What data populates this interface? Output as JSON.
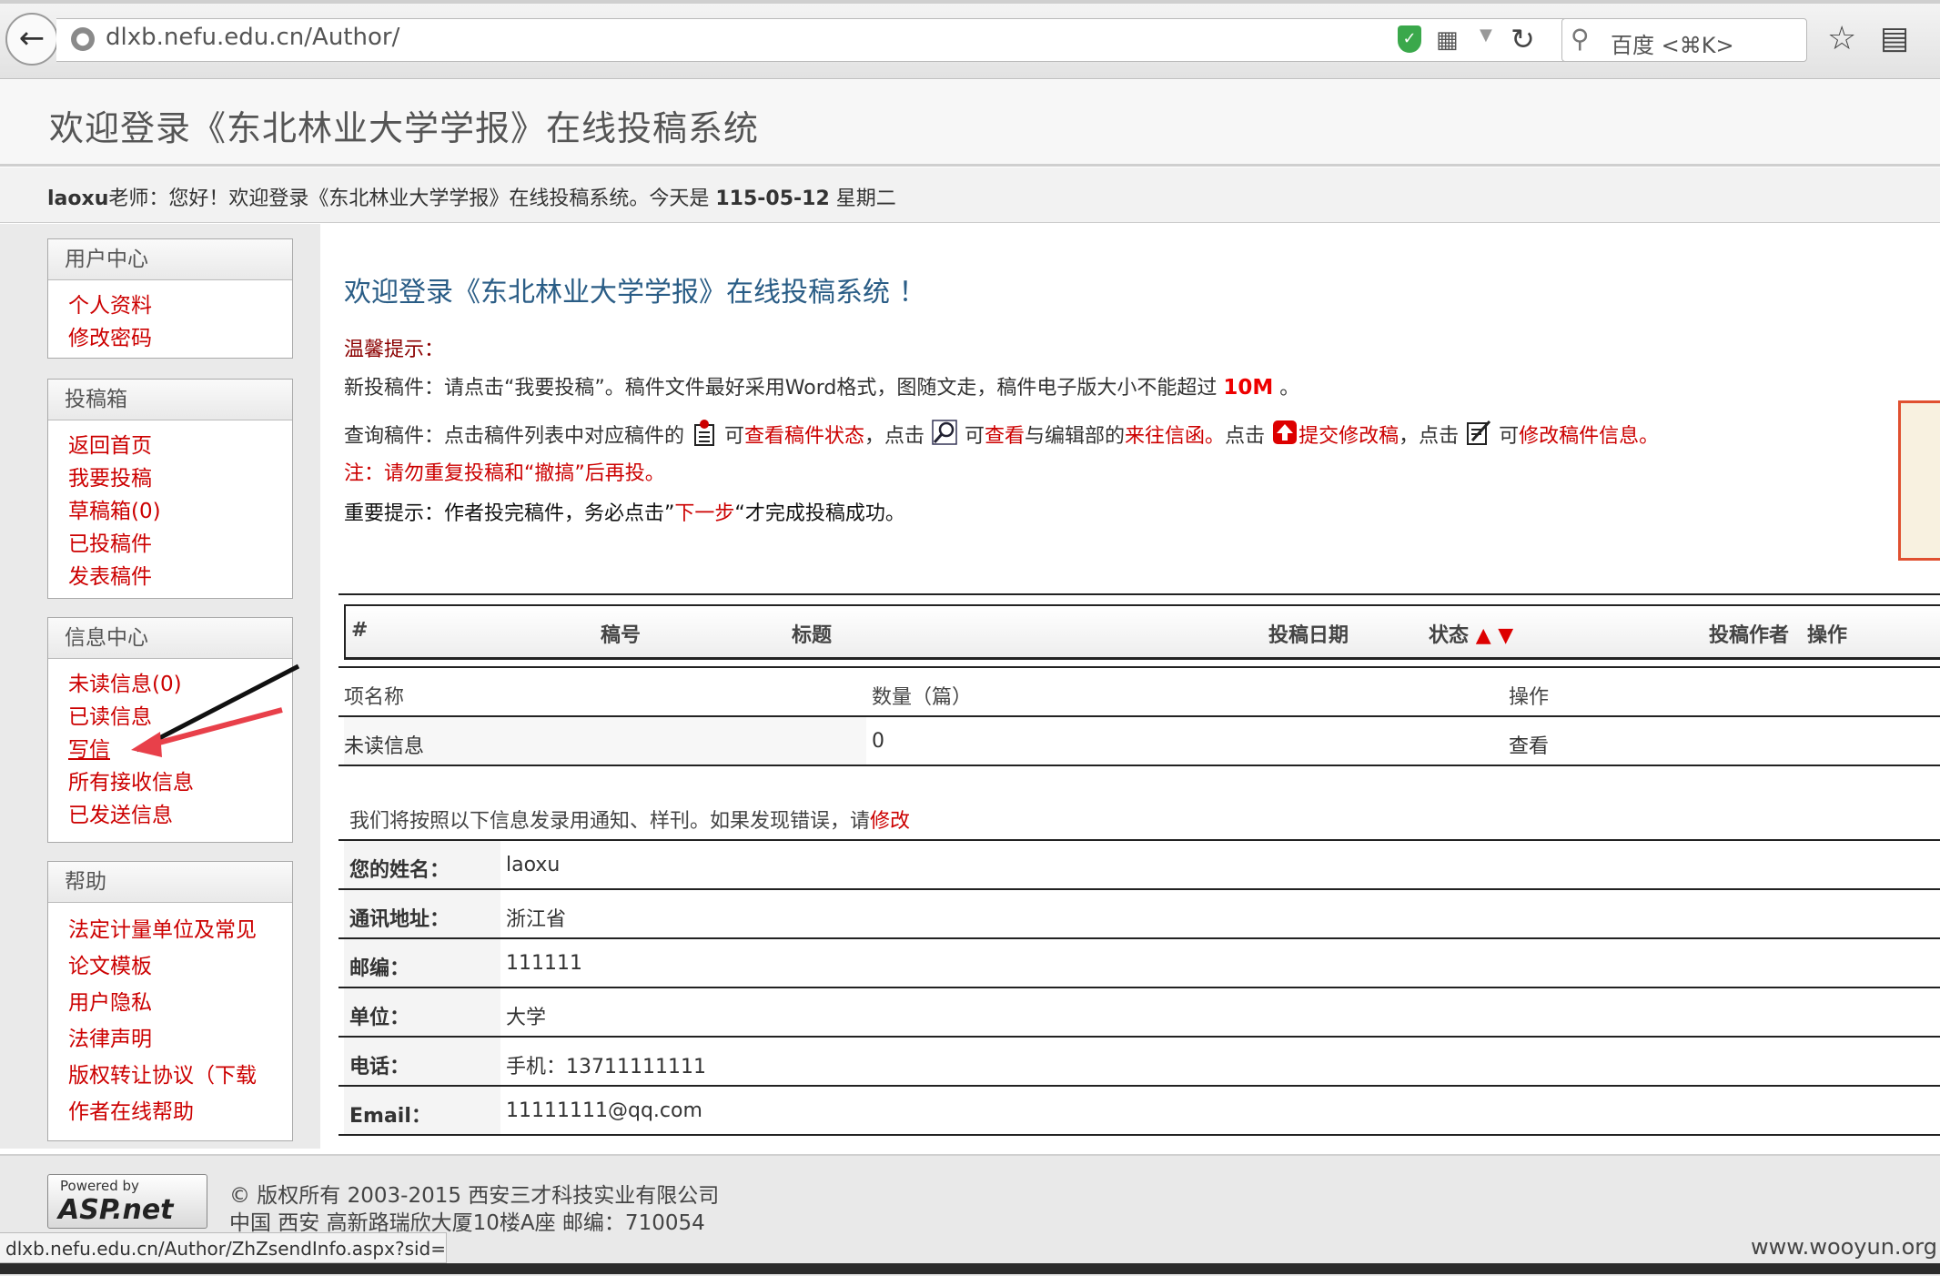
{
  "browser": {
    "url": "dlxb.nefu.edu.cn/Author/",
    "search_placeholder": "百度 <⌘K>",
    "status_url": "dlxb.nefu.edu.cn/Author/ZhZsendInfo.aspx?sid="
  },
  "header": {
    "title": "欢迎登录《东北林业大学学报》在线投稿系统",
    "greeting_user": "laoxu",
    "greeting_rest": "老师：您好！欢迎登录《东北林业大学学报》在线投稿系统。今天是 ",
    "date": "115-05-12",
    "weekday": " 星期二"
  },
  "sidebar": {
    "user_center": {
      "title": "用户中心",
      "items": [
        "个人资料",
        "修改密码"
      ]
    },
    "submission_box": {
      "title": "投稿箱",
      "items": [
        "返回首页",
        "我要投稿",
        "草稿箱(0)",
        "已投稿件",
        "发表稿件"
      ]
    },
    "message_center": {
      "title": "信息中心",
      "items": [
        "未读信息(0)",
        "已读信息",
        "写信",
        "所有接收信息",
        "已发送信息"
      ]
    },
    "help": {
      "title": "帮助",
      "items": [
        "法定计量单位及常见",
        "论文模板",
        "用户隐私",
        "法律声明",
        "版权转让协议（下载",
        "作者在线帮助"
      ]
    }
  },
  "main": {
    "title": "欢迎登录《东北林业大学学报》在线投稿系统 ！",
    "tips_label": "温馨提示：",
    "new_submission": {
      "prefix": "新投稿件：请点击“我要投稿”。稿件文件最好采用Word格式，图随文走，稿件电子版大小不能超过 ",
      "size": "10M",
      "suffix": " 。"
    },
    "query": {
      "p1": "查询稿件：点击稿件列表中对应稿件的 ",
      "p2": " 可",
      "l1": "查看稿件状态",
      "p3": "，点击 ",
      "p4": " 可",
      "l2": "查看",
      "p5": "与编辑部的",
      "l3": "来往信函。",
      "p6": "点击 ",
      "l4": "提交修改稿",
      "p7": "，点击 ",
      "p8": " 可",
      "l5": "修改稿件信息。"
    },
    "note": "注：请勿重复投稿和“撤搞”后再投。",
    "important": {
      "p1": "重要提示：作者投完稿件，务必点击”",
      "link": "下一步",
      "p2": "“才完成投稿成功。"
    },
    "manuscript_table": {
      "headers": [
        "#",
        "稿号",
        "标题",
        "投稿日期",
        "状态",
        "▲",
        "▼",
        "投稿作者",
        "操作"
      ]
    },
    "message_table": {
      "headers": [
        "项名称",
        "数量（篇）",
        "操作"
      ],
      "row": {
        "name": "未读信息",
        "count": "0",
        "action": "查看"
      }
    },
    "info_note": {
      "text": "我们将按照以下信息发录用通知、样刊。如果发现错误，请",
      "link": "修改"
    },
    "profile": [
      {
        "label": "您的姓名：",
        "value": "laoxu"
      },
      {
        "label": "通讯地址：",
        "value": "浙江省"
      },
      {
        "label": "邮编：",
        "value": "111111"
      },
      {
        "label": "单位：",
        "value": "大学"
      },
      {
        "label": "电话：",
        "value": "手机：13711111111"
      },
      {
        "label": "Email：",
        "value": "11111111@qq.com"
      }
    ]
  },
  "footer": {
    "powered_small": "Powered by",
    "powered_big": "ASP.net",
    "copyright": "© 版权所有 2003-2015 西安三才科技实业有限公司",
    "address": "中国 西安 高新路瑞欣大厦10楼A座 邮编：710054"
  },
  "watermark": "www.wooyun.org",
  "colors": {
    "link": "#cc0000",
    "title_blue": "#2a5d86",
    "annotation_arrow": "#e8404a"
  }
}
